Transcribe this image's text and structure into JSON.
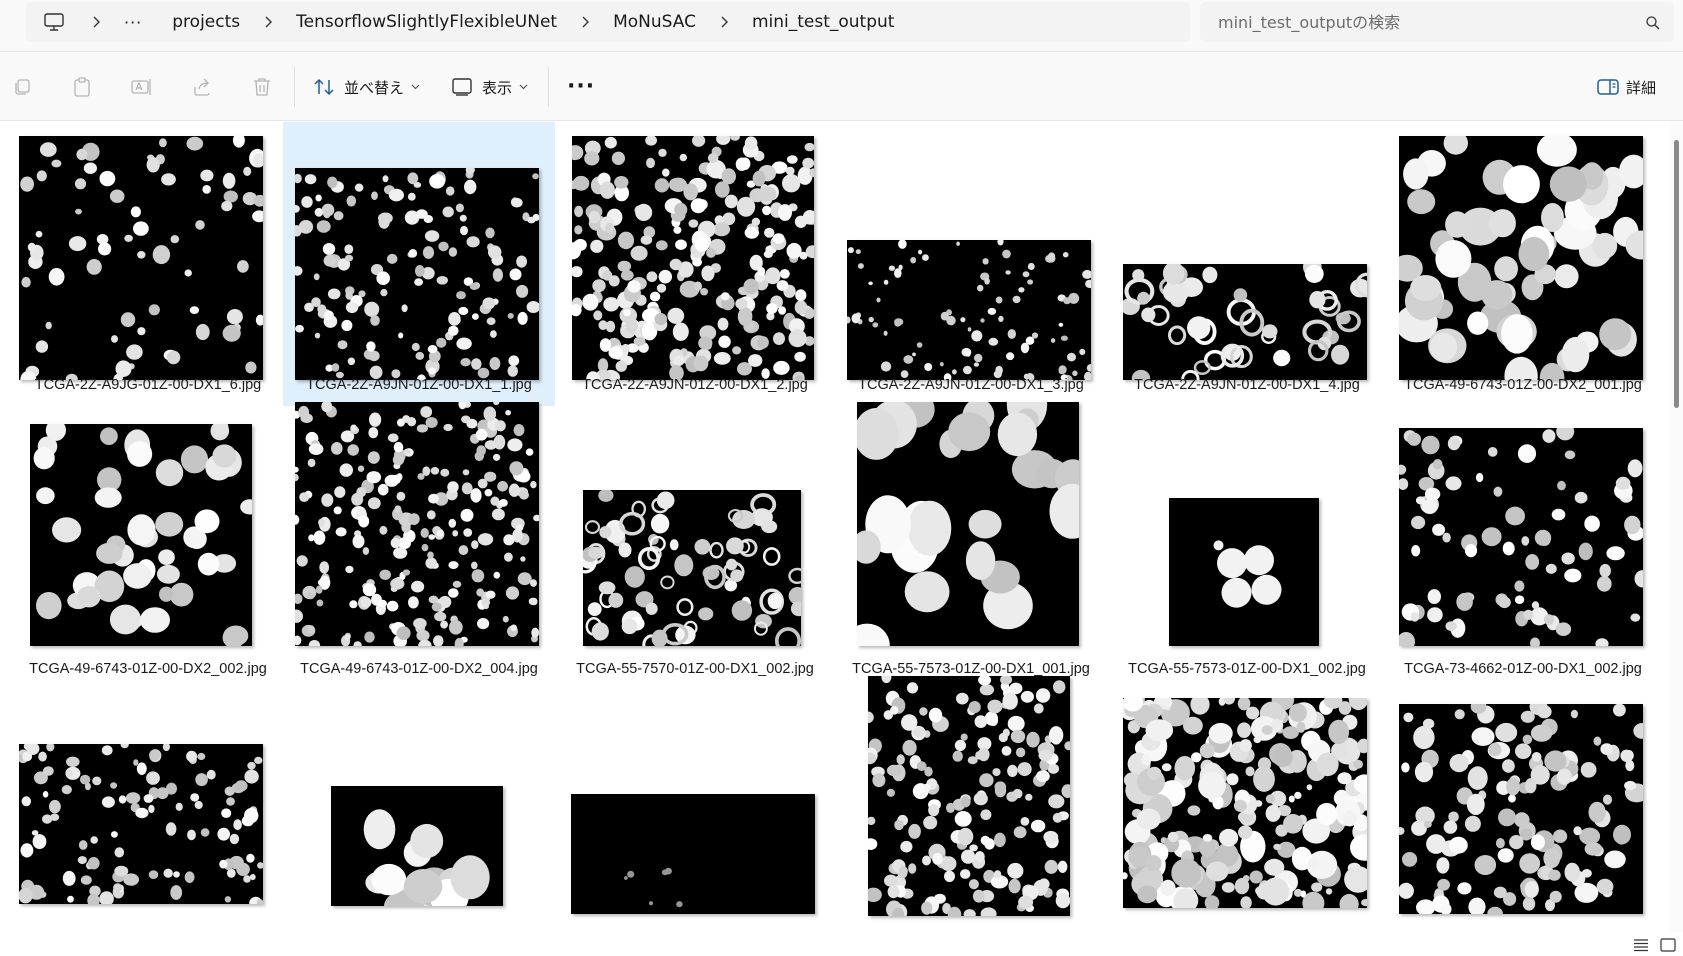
{
  "breadcrumb": {
    "more": "···",
    "items": [
      "projects",
      "TensorflowSlightlyFlexibleUNet",
      "MoNuSAC",
      "mini_test_output"
    ]
  },
  "search": {
    "placeholder": "mini_test_outputの検索"
  },
  "toolbar": {
    "sort_label": "並べ替え",
    "view_label": "表示",
    "more_label": "···",
    "details_label": "詳細"
  },
  "files": [
    {
      "name": "TCGA-2Z-A9JG-01Z-00-DX1_6.jpg",
      "selected": false
    },
    {
      "name": "TCGA-2Z-A9JN-01Z-00-DX1_1.jpg",
      "selected": true
    },
    {
      "name": "TCGA-2Z-A9JN-01Z-00-DX1_2.jpg",
      "selected": false
    },
    {
      "name": "TCGA-2Z-A9JN-01Z-00-DX1_3.jpg",
      "selected": false
    },
    {
      "name": "TCGA-2Z-A9JN-01Z-00-DX1_4.jpg",
      "selected": false
    },
    {
      "name": "TCGA-49-6743-01Z-00-DX2_001.jpg",
      "selected": false
    },
    {
      "name": "TCGA-49-6743-01Z-00-DX2_002.jpg",
      "selected": false
    },
    {
      "name": "TCGA-49-6743-01Z-00-DX2_004.jpg",
      "selected": false
    },
    {
      "name": "TCGA-55-7570-01Z-00-DX1_002.jpg",
      "selected": false
    },
    {
      "name": "TCGA-55-7573-01Z-00-DX1_001.jpg",
      "selected": false
    },
    {
      "name": "TCGA-55-7573-01Z-00-DX1_002.jpg",
      "selected": false
    },
    {
      "name": "TCGA-73-4662-01Z-00-DX1_002.jpg",
      "selected": false
    },
    {
      "name": "",
      "selected": false
    },
    {
      "name": "",
      "selected": false
    },
    {
      "name": "",
      "selected": false
    },
    {
      "name": "",
      "selected": false
    },
    {
      "name": "",
      "selected": false
    },
    {
      "name": "",
      "selected": false
    }
  ],
  "colors": {
    "selection": "#dff0fc",
    "accent": "#0067c0",
    "background": "#ffffff"
  }
}
